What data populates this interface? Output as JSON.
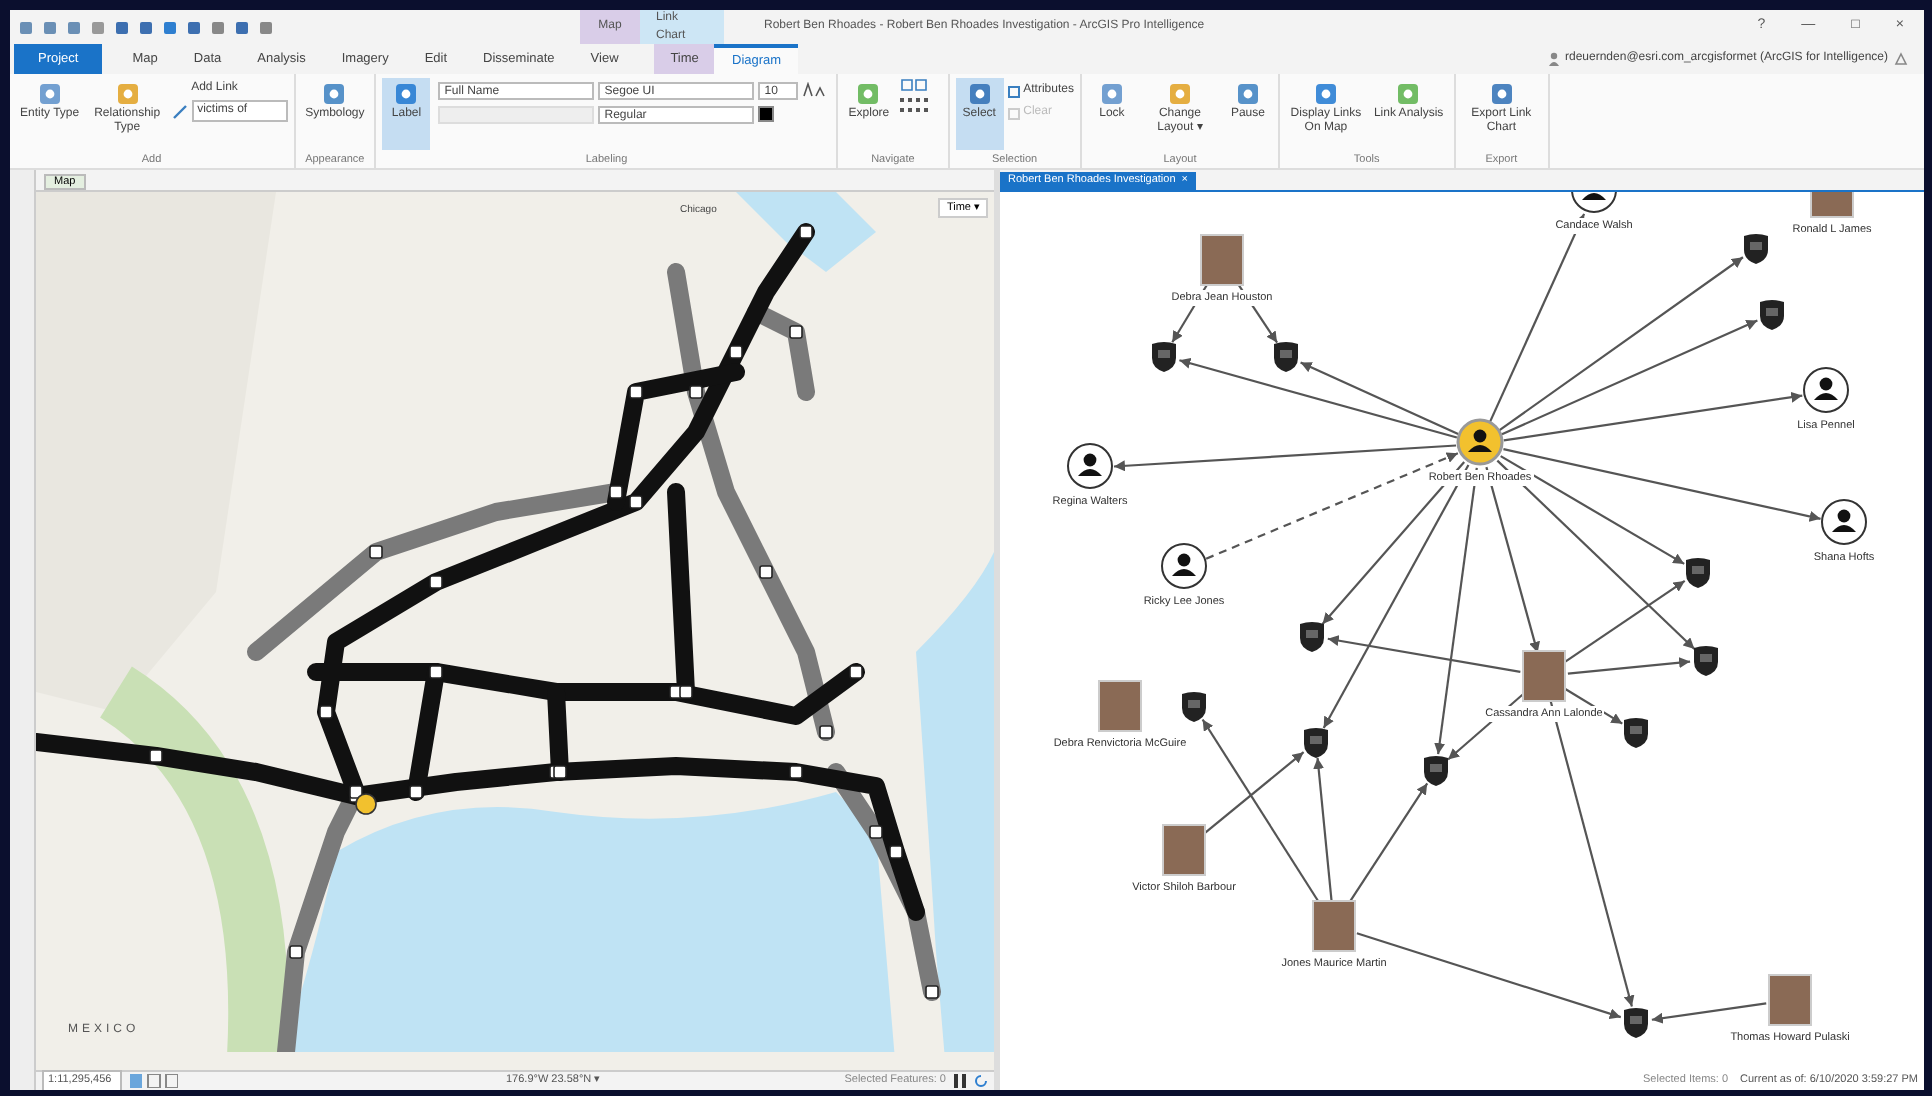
{
  "title_bar": {
    "context_groups": [
      {
        "label": "Map",
        "kind": "map"
      },
      {
        "label": "Link Chart",
        "kind": "linkchart"
      }
    ],
    "title": "Robert Ben Rhoades - Robert Ben Rhoades Investigation - ArcGIS Pro Intelligence",
    "window_controls": [
      "?",
      "—",
      "□",
      "×"
    ]
  },
  "tabs": [
    {
      "label": "Project",
      "kind": "backstage",
      "selected": false
    },
    {
      "label": "Map",
      "kind": "core",
      "selected": false
    },
    {
      "label": "Data",
      "kind": "core",
      "selected": false
    },
    {
      "label": "Analysis",
      "kind": "core",
      "selected": false
    },
    {
      "label": "Imagery",
      "kind": "core",
      "selected": false
    },
    {
      "label": "Edit",
      "kind": "core",
      "selected": false
    },
    {
      "label": "Disseminate",
      "kind": "core",
      "selected": false
    },
    {
      "label": "View",
      "kind": "core",
      "selected": false
    },
    {
      "label": "Time",
      "kind": "map",
      "selected": false
    },
    {
      "label": "Diagram",
      "kind": "linkchart",
      "selected": true
    }
  ],
  "user": "rdeuernden@esri.com_arcgisformet (ArcGIS for Intelligence)",
  "ribbon": [
    {
      "label": "Add",
      "items": [
        {
          "kind": "large",
          "label": "Entity Type",
          "selected": false
        },
        {
          "kind": "large",
          "label": "Relationship Type",
          "selected": false
        },
        {
          "kind": "linkpicker",
          "label": "Add Link",
          "value": "victims of"
        }
      ]
    },
    {
      "label": "Appearance",
      "items": [
        {
          "kind": "large",
          "label": "Symbology",
          "selected": false
        }
      ]
    },
    {
      "label": "Labeling",
      "items": [
        {
          "kind": "large",
          "label": "Label",
          "selected": true
        },
        {
          "kind": "fontbox",
          "field": "Full Name",
          "font": "Segoe UI",
          "size": "10",
          "style": "Regular"
        }
      ]
    },
    {
      "label": "Navigate",
      "items": [
        {
          "kind": "large",
          "label": "Explore",
          "selected": false
        },
        {
          "kind": "icons"
        }
      ]
    },
    {
      "label": "Selection",
      "items": [
        {
          "kind": "large",
          "label": "Select",
          "selected": true
        },
        {
          "kind": "smalls",
          "buttons": [
            {
              "label": "Attributes",
              "disabled": false
            },
            {
              "label": "Clear",
              "disabled": true
            }
          ]
        }
      ]
    },
    {
      "label": "Layout",
      "items": [
        {
          "kind": "large",
          "label": "Lock",
          "selected": false
        },
        {
          "kind": "large",
          "label": "Change Layout ▾",
          "selected": false
        },
        {
          "kind": "large",
          "label": "Pause",
          "selected": false
        }
      ]
    },
    {
      "label": "Tools",
      "items": [
        {
          "kind": "large",
          "label": "Display Links On Map",
          "selected": false
        },
        {
          "kind": "large",
          "label": "Link Analysis",
          "selected": false
        }
      ]
    },
    {
      "label": "Export",
      "items": [
        {
          "kind": "large",
          "label": "Export Link Chart",
          "selected": false
        }
      ]
    }
  ],
  "map_pane": {
    "tab": "Map",
    "time_button": "Time ▾",
    "labels": [
      {
        "text": "Chicago",
        "kind": "city"
      },
      {
        "text": "MEXICO",
        "kind": "country"
      }
    ],
    "status": {
      "scale": "1:11,295,456",
      "coordinates": "176.9°W 23.58°N ▾",
      "selected": "Selected Features: 0"
    }
  },
  "link_chart": {
    "tab": "Robert Ben Rhoades Investigation",
    "tab_close": "×",
    "nodes": [
      {
        "kind": "photo",
        "label": "Debra Jean Houston",
        "selected": false
      },
      {
        "kind": "person",
        "label": "Candace Walsh",
        "selected": false
      },
      {
        "kind": "photo",
        "label": "Ronald L James",
        "selected": false
      },
      {
        "kind": "person",
        "label": "Robert Ben Rhoades",
        "selected": true
      },
      {
        "kind": "person",
        "label": "Lisa Pennel",
        "selected": false
      },
      {
        "kind": "person",
        "label": "Regina Walters",
        "selected": false
      },
      {
        "kind": "person",
        "label": "Shana Hofts",
        "selected": false
      },
      {
        "kind": "person",
        "label": "Ricky Lee Jones",
        "selected": false
      },
      {
        "kind": "photo",
        "label": "Cassandra Ann Lalonde",
        "selected": false
      },
      {
        "kind": "photo",
        "label": "Debra Renvictoria McGuire",
        "selected": false
      },
      {
        "kind": "photo",
        "label": "Victor Shiloh Barbour",
        "selected": false
      },
      {
        "kind": "photo",
        "label": "Jones Maurice Martin",
        "selected": false
      },
      {
        "kind": "photo",
        "label": "Thomas Howard Pulaski",
        "selected": false
      },
      {
        "kind": "place",
        "selected": false
      },
      {
        "kind": "place",
        "selected": false
      },
      {
        "kind": "place",
        "selected": false
      },
      {
        "kind": "place",
        "selected": false
      },
      {
        "kind": "place",
        "selected": false
      },
      {
        "kind": "place",
        "selected": false
      },
      {
        "kind": "place",
        "selected": false
      },
      {
        "kind": "place",
        "selected": false
      },
      {
        "kind": "place",
        "selected": false
      },
      {
        "kind": "place",
        "selected": false
      },
      {
        "kind": "place",
        "selected": false
      },
      {
        "kind": "place",
        "selected": false
      }
    ],
    "status": {
      "selected": "Selected Items: 0",
      "current": "Current as of: 6/10/2020 3:59:27 PM"
    }
  }
}
